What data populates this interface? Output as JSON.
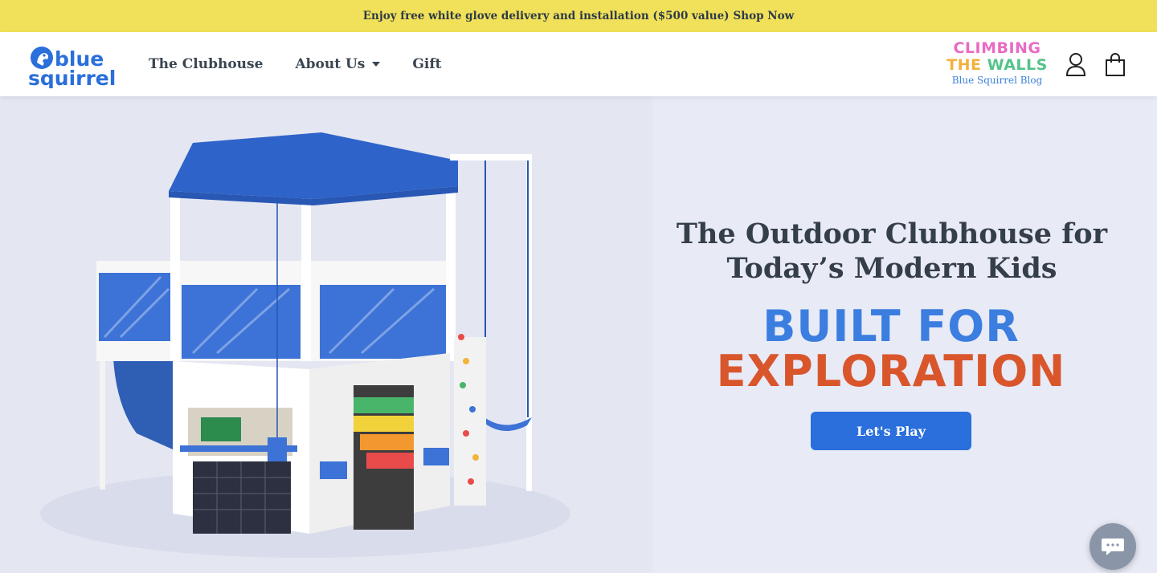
{
  "announcement": {
    "text": "Enjoy free white glove delivery and installation ($500 value)",
    "link": "Shop Now"
  },
  "header": {
    "logo_text_1": "blue",
    "logo_text_2": "squirrel",
    "nav": [
      {
        "label": "The Clubhouse"
      },
      {
        "label": "About Us"
      },
      {
        "label": "Gift"
      }
    ],
    "blog": {
      "line1": "CLIMBING",
      "line2_a": "THE ",
      "line2_b": "WALLS",
      "sub": "Blue Squirrel Blog"
    }
  },
  "hero": {
    "headline_1": "The Outdoor Clubhouse for",
    "headline_2": "Today’s Modern Kids",
    "tag_1": "BUILT FOR",
    "tag_2": "EXPLORATION",
    "cta": "Let's Play"
  },
  "colors": {
    "announcement_bg": "#f1e15a",
    "brand_blue": "#2a6fdb",
    "accent_orange": "#d9562c",
    "hero_bg": "#e8eaf6"
  },
  "icons": [
    "account-icon",
    "cart-icon",
    "chat-icon",
    "caret-down-icon"
  ]
}
